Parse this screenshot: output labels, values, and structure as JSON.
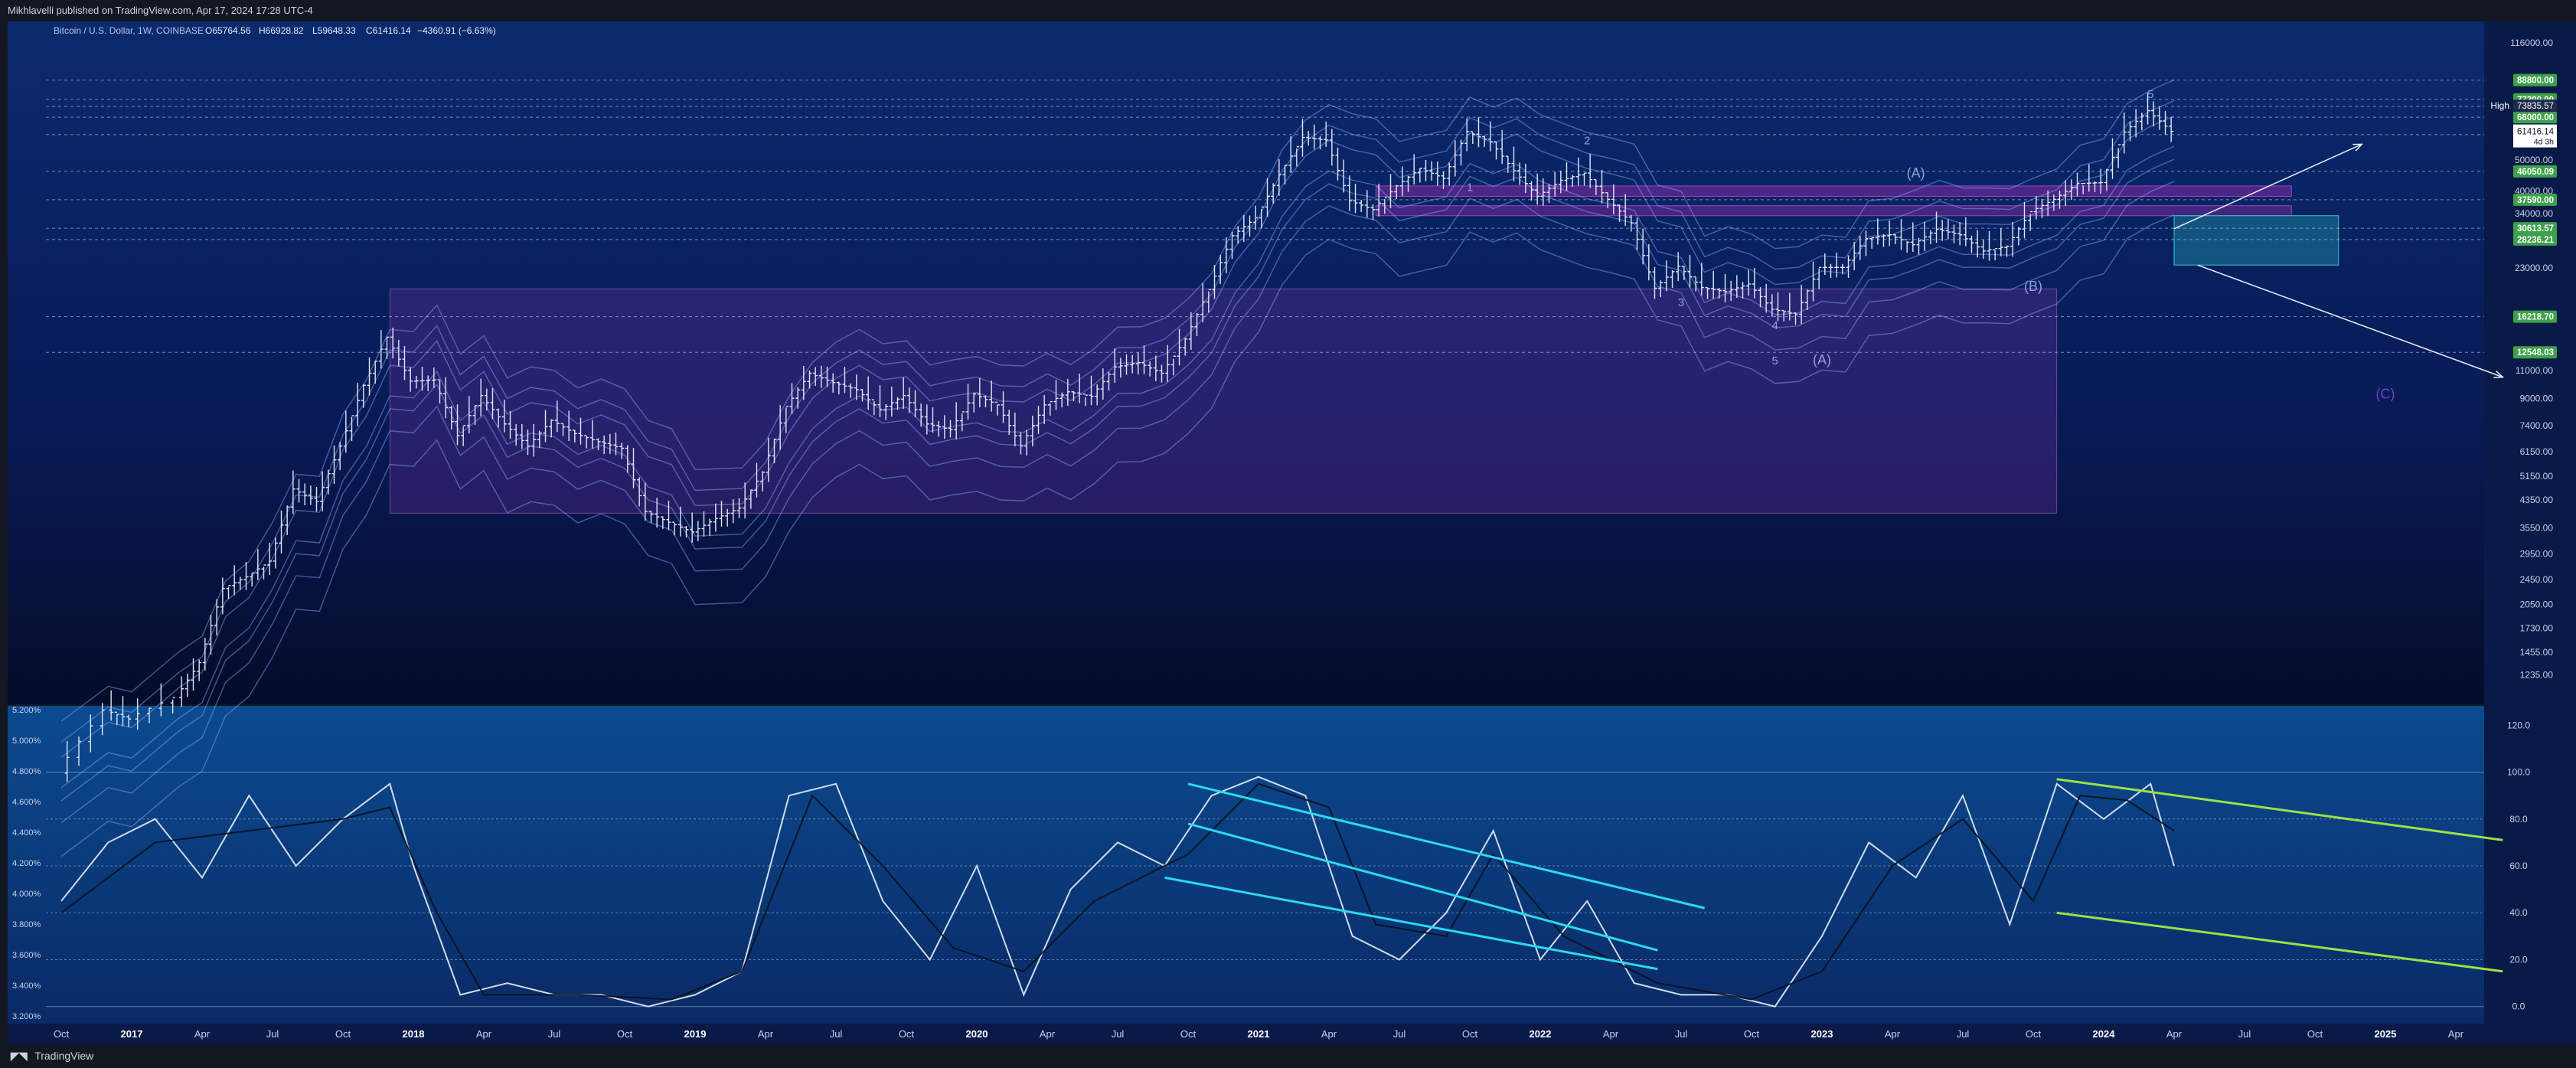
{
  "header": {
    "publisher": "Mikhlavelli published on TradingView.com, Apr 17, 2024 17:28 UTC-4"
  },
  "footer": {
    "brand": "TradingView"
  },
  "colors": {
    "background_top": "#0a1e5c",
    "background_bottom": "#06102d",
    "osc_background": "#0b3f7d",
    "candle": "#dfe6f5",
    "ribbon": "#8ea7ff",
    "zone_magenta": "#b233c9",
    "zone_teal": "#33c9c9",
    "cyan_channel": "#2ad9f0",
    "green_wedge": "#9be04a",
    "price_label_green": "#3ea04a"
  },
  "chart_data": [
    {
      "type": "candlestick",
      "title": "Bitcoin / U.S. Dollar, 1W, COINBASE",
      "ohlc": {
        "open": "O65764.56",
        "high": "H66928.82",
        "low": "L59648.33",
        "close": "C61416.14",
        "change": "−4360.91 (−6.63%)"
      },
      "scale": "log",
      "ylim": [
        1000,
        116000
      ],
      "x_ticks": [
        "Oct",
        "2017",
        "Apr",
        "Jul",
        "Oct",
        "2018",
        "Apr",
        "Jul",
        "Oct",
        "2019",
        "Apr",
        "Jul",
        "Oct",
        "2020",
        "Apr",
        "Jul",
        "Oct",
        "2021",
        "Apr",
        "Jul",
        "Oct",
        "2022",
        "Apr",
        "Jul",
        "Oct",
        "2023",
        "Apr",
        "Jul",
        "Oct",
        "2024",
        "Apr",
        "Jul",
        "Oct",
        "2025",
        "Apr"
      ],
      "y_ticks": [
        "116000.00",
        "68000.00",
        "50000.00",
        "40000.00",
        "34000.00",
        "23000.00",
        "11000.00",
        "9000.00",
        "7400.00",
        "6150.00",
        "5150.00",
        "4350.00",
        "3550.00",
        "2950.00",
        "2450.00",
        "2050.00",
        "1730.00",
        "1455.00",
        "1235.00"
      ],
      "price_labels": [
        "88800.00",
        "77300.00",
        "73480.25",
        "68000.00",
        "46050.09",
        "37590.00",
        "30613.57",
        "28236.21",
        "16218.70",
        "12548.03"
      ],
      "high_label": "High",
      "high_value": "73835.57",
      "current_price": "61416.14",
      "countdown": "4d 3h",
      "horizontal_levels": [
        88800,
        77300,
        73480.25,
        68000,
        60000,
        46050.09,
        37590,
        30613.57,
        28236.21,
        16218.7,
        12548.03
      ],
      "wave_labels": [
        "1",
        "2",
        "3",
        "4",
        "5",
        "(A)",
        "(B)",
        "(C)",
        "5",
        "(A)"
      ],
      "zones": [
        {
          "name": "purple-range",
          "from": "2017-12",
          "to": "2023-11",
          "low": 3950,
          "high": 19800
        },
        {
          "name": "magenta-resistance",
          "from": "2021-06",
          "to": "2024-09",
          "low": 38500,
          "high": 41500
        },
        {
          "name": "magenta-support",
          "from": "2021-06",
          "to": "2024-09",
          "low": 33500,
          "high": 36000
        },
        {
          "name": "teal-target",
          "from": "2024-04",
          "to": "2024-11",
          "low": 23500,
          "high": 33500
        }
      ],
      "forecast": [
        {
          "from": {
            "date": "2024-04",
            "price": 30500
          },
          "to": {
            "date": "2024-12",
            "price": 56000
          }
        },
        {
          "from": {
            "date": "2024-05",
            "price": 23500
          },
          "to": {
            "date": "2025-06",
            "price": 10500
          }
        }
      ],
      "series": [
        {
          "name": "BTC weekly close",
          "points": [
            [
              "2016-10",
              610
            ],
            [
              "2016-12",
              960
            ],
            [
              "2017-01",
              900
            ],
            [
              "2017-03",
              1050
            ],
            [
              "2017-04",
              1350
            ],
            [
              "2017-05",
              2300
            ],
            [
              "2017-06",
              2500
            ],
            [
              "2017-07",
              2800
            ],
            [
              "2017-08",
              4700
            ],
            [
              "2017-09",
              4300
            ],
            [
              "2017-10",
              6400
            ],
            [
              "2017-11",
              9900
            ],
            [
              "2017-12",
              14000
            ],
            [
              "2018-01",
              10200
            ],
            [
              "2018-02",
              10300
            ],
            [
              "2018-03",
              6900
            ],
            [
              "2018-04",
              9200
            ],
            [
              "2018-05",
              7500
            ],
            [
              "2018-06",
              6400
            ],
            [
              "2018-07",
              7700
            ],
            [
              "2018-08",
              7000
            ],
            [
              "2018-09",
              6600
            ],
            [
              "2018-10",
              6300
            ],
            [
              "2018-11",
              4000
            ],
            [
              "2018-12",
              3700
            ],
            [
              "2019-01",
              3450
            ],
            [
              "2019-02",
              3800
            ],
            [
              "2019-03",
              4100
            ],
            [
              "2019-04",
              5300
            ],
            [
              "2019-05",
              8500
            ],
            [
              "2019-06",
              10800
            ],
            [
              "2019-07",
              10100
            ],
            [
              "2019-08",
              9600
            ],
            [
              "2019-09",
              8300
            ],
            [
              "2019-10",
              9200
            ],
            [
              "2019-11",
              7500
            ],
            [
              "2019-12",
              7200
            ],
            [
              "2020-01",
              9300
            ],
            [
              "2020-02",
              8600
            ],
            [
              "2020-03",
              6400
            ],
            [
              "2020-04",
              8600
            ],
            [
              "2020-05",
              9450
            ],
            [
              "2020-06",
              9150
            ],
            [
              "2020-07",
              11300
            ],
            [
              "2020-08",
              11650
            ],
            [
              "2020-09",
              10800
            ],
            [
              "2020-10",
              13800
            ],
            [
              "2020-11",
              19700
            ],
            [
              "2020-12",
              29000
            ],
            [
              "2021-01",
              33000
            ],
            [
              "2021-02",
              45000
            ],
            [
              "2021-03",
              58800
            ],
            [
              "2021-04",
              57700
            ],
            [
              "2021-05",
              37300
            ],
            [
              "2021-06",
              35000
            ],
            [
              "2021-07",
              41500
            ],
            [
              "2021-08",
              47100
            ],
            [
              "2021-09",
              43800
            ],
            [
              "2021-10",
              61300
            ],
            [
              "2021-11",
              57000
            ],
            [
              "2021-12",
              46300
            ],
            [
              "2022-01",
              38500
            ],
            [
              "2022-02",
              43200
            ],
            [
              "2022-03",
              45500
            ],
            [
              "2022-04",
              37700
            ],
            [
              "2022-05",
              31800
            ],
            [
              "2022-06",
              19900
            ],
            [
              "2022-07",
              23300
            ],
            [
              "2022-08",
              20000
            ],
            [
              "2022-09",
              19400
            ],
            [
              "2022-10",
              20500
            ],
            [
              "2022-11",
              17100
            ],
            [
              "2022-12",
              16500
            ],
            [
              "2023-01",
              23100
            ],
            [
              "2023-02",
              23100
            ],
            [
              "2023-03",
              28400
            ],
            [
              "2023-04",
              29200
            ],
            [
              "2023-05",
              27200
            ],
            [
              "2023-06",
              30400
            ],
            [
              "2023-07",
              29200
            ],
            [
              "2023-08",
              26000
            ],
            [
              "2023-09",
              26900
            ],
            [
              "2023-10",
              34500
            ],
            [
              "2023-11",
              37700
            ],
            [
              "2023-12",
              42200
            ],
            [
              "2024-01",
              42500
            ],
            [
              "2024-02",
              61100
            ],
            [
              "2024-03",
              71300
            ],
            [
              "2024-04",
              61400
            ]
          ]
        }
      ]
    },
    {
      "type": "line",
      "name": "oscillator",
      "y_ticks_right": [
        "120.0",
        "100.0",
        "80.0",
        "60.0",
        "40.0",
        "20.0",
        "0.0"
      ],
      "y_ticks_left": [
        "5.200%",
        "5.000%",
        "4.800%",
        "4.600%",
        "4.400%",
        "4.200%",
        "4.000%",
        "3.800%",
        "3.600%",
        "3.400%",
        "3.200%"
      ],
      "ylim": [
        -5,
        125
      ],
      "levels": [
        100,
        80,
        60,
        40,
        20,
        0
      ],
      "series": [
        {
          "name": "stoch-rsi",
          "points": [
            [
              "2016-10",
              45
            ],
            [
              "2016-12",
              70
            ],
            [
              "2017-02",
              80
            ],
            [
              "2017-04",
              55
            ],
            [
              "2017-06",
              90
            ],
            [
              "2017-08",
              60
            ],
            [
              "2017-10",
              80
            ],
            [
              "2017-12",
              95
            ],
            [
              "2018-01",
              60
            ],
            [
              "2018-03",
              5
            ],
            [
              "2018-05",
              10
            ],
            [
              "2018-07",
              5
            ],
            [
              "2018-09",
              5
            ],
            [
              "2018-11",
              0
            ],
            [
              "2019-01",
              5
            ],
            [
              "2019-03",
              15
            ],
            [
              "2019-05",
              90
            ],
            [
              "2019-07",
              95
            ],
            [
              "2019-09",
              45
            ],
            [
              "2019-11",
              20
            ],
            [
              "2020-01",
              60
            ],
            [
              "2020-03",
              5
            ],
            [
              "2020-05",
              50
            ],
            [
              "2020-07",
              70
            ],
            [
              "2020-09",
              60
            ],
            [
              "2020-11",
              90
            ],
            [
              "2021-01",
              98
            ],
            [
              "2021-03",
              90
            ],
            [
              "2021-05",
              30
            ],
            [
              "2021-07",
              20
            ],
            [
              "2021-09",
              40
            ],
            [
              "2021-11",
              75
            ],
            [
              "2022-01",
              20
            ],
            [
              "2022-03",
              45
            ],
            [
              "2022-05",
              10
            ],
            [
              "2022-07",
              5
            ],
            [
              "2022-09",
              5
            ],
            [
              "2022-11",
              0
            ],
            [
              "2023-01",
              30
            ],
            [
              "2023-03",
              70
            ],
            [
              "2023-05",
              55
            ],
            [
              "2023-07",
              90
            ],
            [
              "2023-09",
              35
            ],
            [
              "2023-11",
              95
            ],
            [
              "2024-01",
              80
            ],
            [
              "2024-03",
              95
            ],
            [
              "2024-04",
              60
            ]
          ]
        },
        {
          "name": "signal",
          "points": [
            [
              "2016-10",
              40
            ],
            [
              "2017-02",
              70
            ],
            [
              "2017-06",
              75
            ],
            [
              "2017-10",
              80
            ],
            [
              "2017-12",
              85
            ],
            [
              "2018-02",
              40
            ],
            [
              "2018-04",
              5
            ],
            [
              "2018-08",
              5
            ],
            [
              "2018-12",
              3
            ],
            [
              "2019-03",
              15
            ],
            [
              "2019-06",
              90
            ],
            [
              "2019-09",
              60
            ],
            [
              "2019-12",
              25
            ],
            [
              "2020-03",
              15
            ],
            [
              "2020-06",
              45
            ],
            [
              "2020-10",
              65
            ],
            [
              "2021-01",
              95
            ],
            [
              "2021-04",
              85
            ],
            [
              "2021-06",
              35
            ],
            [
              "2021-09",
              30
            ],
            [
              "2021-11",
              65
            ],
            [
              "2022-02",
              30
            ],
            [
              "2022-06",
              10
            ],
            [
              "2022-10",
              3
            ],
            [
              "2023-01",
              15
            ],
            [
              "2023-04",
              60
            ],
            [
              "2023-07",
              80
            ],
            [
              "2023-10",
              45
            ],
            [
              "2023-12",
              90
            ],
            [
              "2024-02",
              88
            ],
            [
              "2024-04",
              75
            ]
          ]
        }
      ],
      "channels": [
        {
          "name": "cyan-upper",
          "from": [
            "2020-10",
            95
          ],
          "to": [
            "2022-08",
            42
          ]
        },
        {
          "name": "cyan-lower",
          "from": [
            "2020-09",
            55
          ],
          "to": [
            "2022-06",
            16
          ]
        },
        {
          "name": "cyan-middle",
          "from": [
            "2020-10",
            78
          ],
          "to": [
            "2022-06",
            24
          ]
        },
        {
          "name": "green-upper",
          "from": [
            "2023-11",
            97
          ],
          "to": [
            "2025-06",
            71
          ]
        },
        {
          "name": "green-lower",
          "from": [
            "2023-11",
            40
          ],
          "to": [
            "2025-06",
            15
          ]
        }
      ]
    }
  ]
}
